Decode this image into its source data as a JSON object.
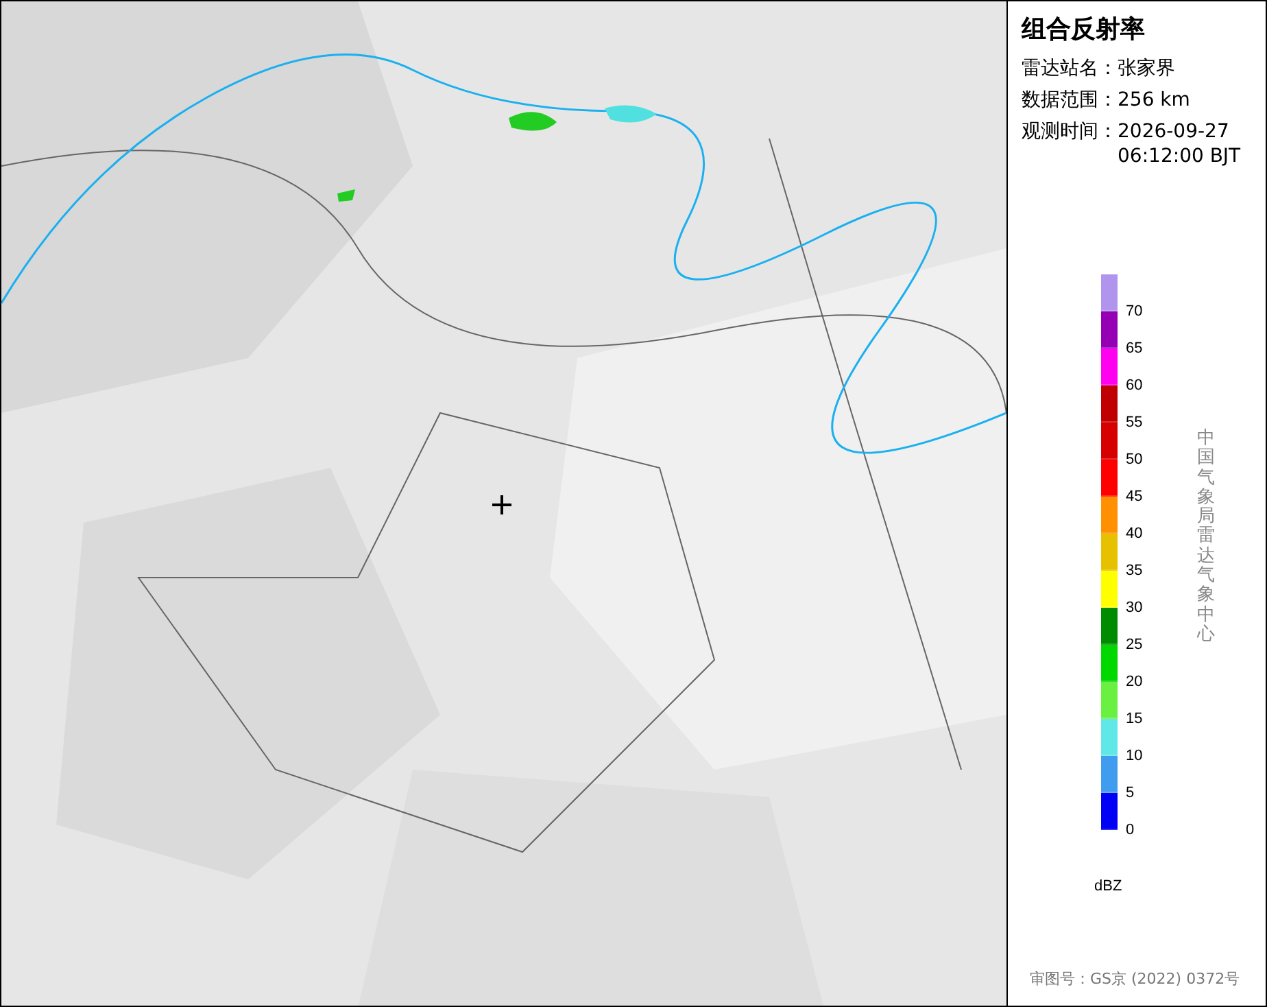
{
  "panel": {
    "title": "组合反射率",
    "info": [
      {
        "label": "雷达站名：",
        "value": "张家界"
      },
      {
        "label": "数据范围：",
        "value": "256 km"
      },
      {
        "label": "观测时间：",
        "value": "2026-09-27 06:12:00 BJT"
      }
    ],
    "legend": {
      "segments": [
        {
          "color": "#b094ee",
          "label": "70"
        },
        {
          "color": "#9600b4",
          "label": "65"
        },
        {
          "color": "#ff00f0",
          "label": "60"
        },
        {
          "color": "#c00000",
          "label": "55"
        },
        {
          "color": "#d60000",
          "label": "50"
        },
        {
          "color": "#ff0000",
          "label": "45"
        },
        {
          "color": "#ff9000",
          "label": "40"
        },
        {
          "color": "#e7c000",
          "label": "35"
        },
        {
          "color": "#ffff00",
          "label": "30"
        },
        {
          "color": "#008c00",
          "label": "25"
        },
        {
          "color": "#00d800",
          "label": "20"
        },
        {
          "color": "#6af040",
          "label": "15"
        },
        {
          "color": "#60e8e8",
          "label": "10"
        },
        {
          "color": "#409cee",
          "label": "5"
        },
        {
          "color": "#0000f6",
          "label": "0"
        }
      ],
      "unit": "dBZ"
    },
    "agency": "中国气象局雷达气象中心",
    "footer": "审图号：GS京 (2022) 0372号"
  }
}
